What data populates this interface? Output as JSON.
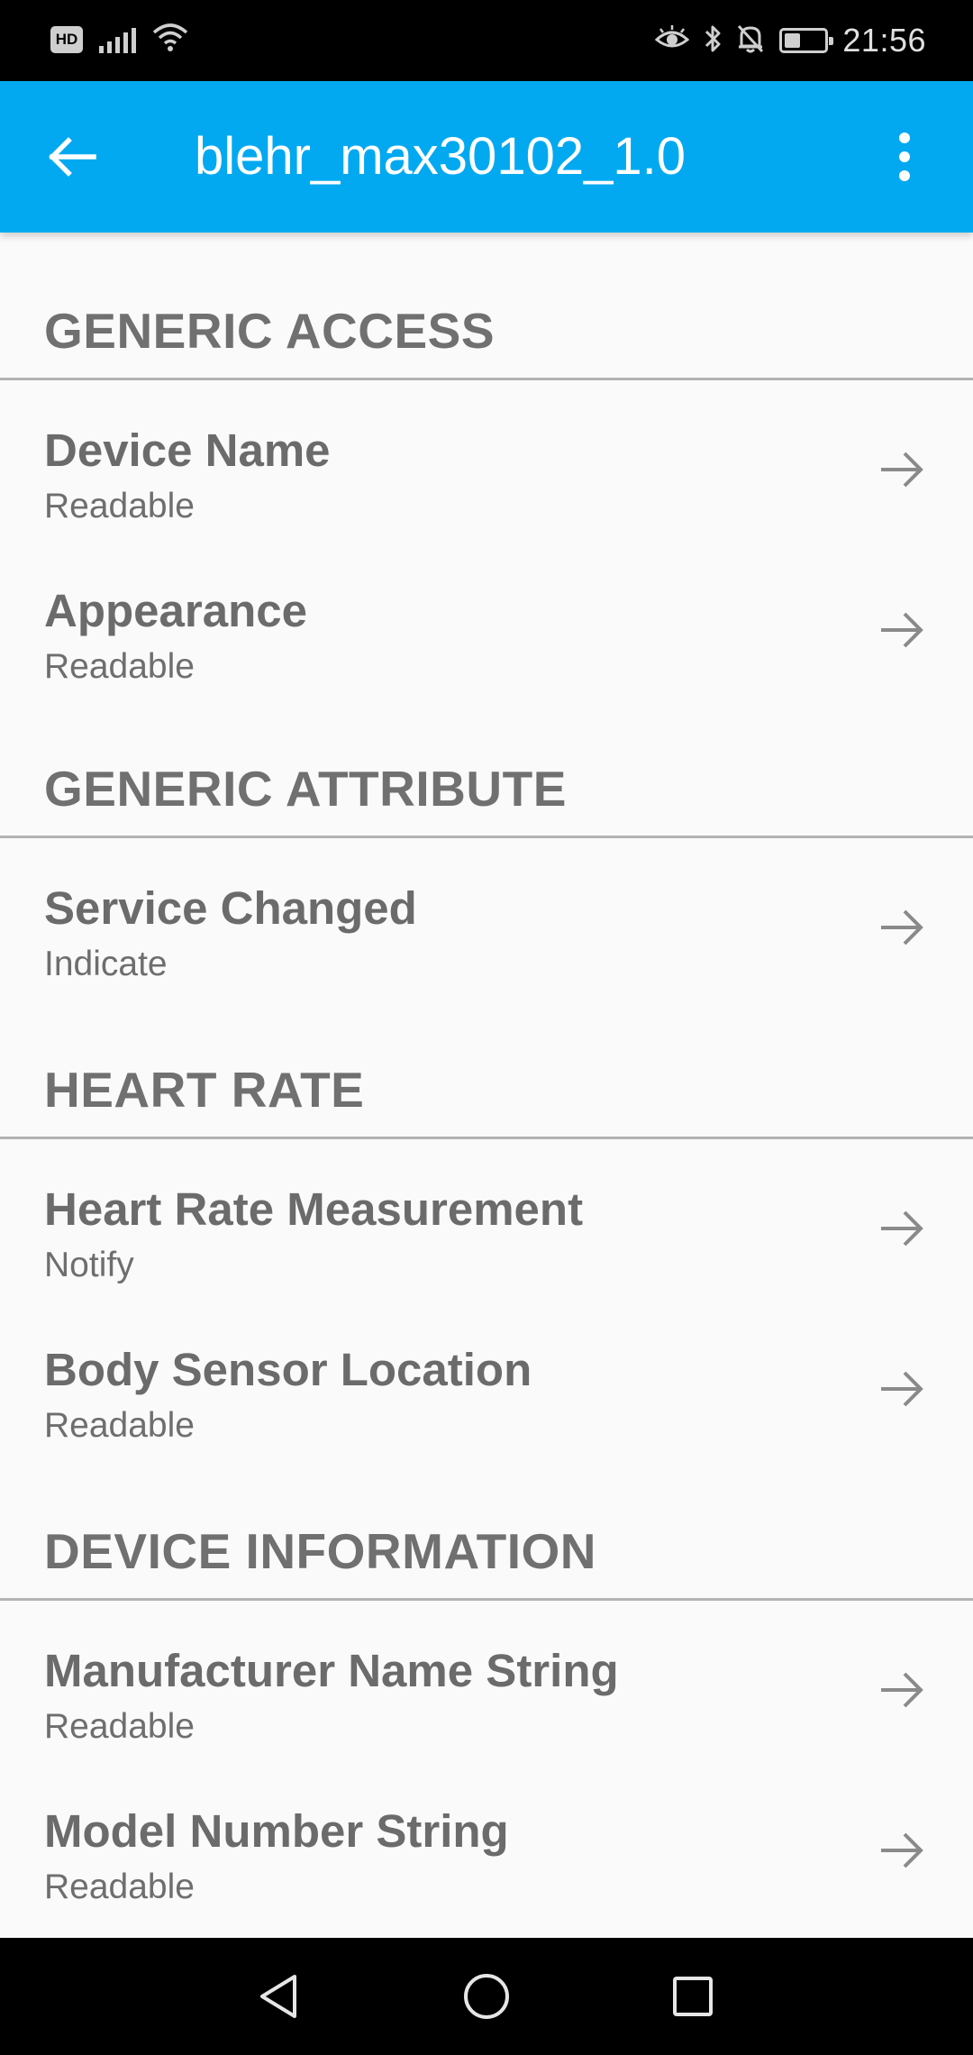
{
  "status_bar": {
    "hd_label": "HD",
    "time": "21:56",
    "icons": [
      "signal-icon",
      "wifi-icon",
      "eye-comfort-icon",
      "bluetooth-icon",
      "mute-bell-icon",
      "battery-icon"
    ],
    "battery_level": 0.4
  },
  "app_bar": {
    "title": "blehr_max30102_1.0",
    "background": "#03a9f0"
  },
  "sections": [
    {
      "title": "GENERIC ACCESS",
      "items": [
        {
          "name": "Device Name",
          "property": "Readable"
        },
        {
          "name": "Appearance",
          "property": "Readable"
        }
      ]
    },
    {
      "title": "GENERIC ATTRIBUTE",
      "items": [
        {
          "name": "Service Changed",
          "property": "Indicate"
        }
      ]
    },
    {
      "title": "HEART RATE",
      "items": [
        {
          "name": "Heart Rate Measurement",
          "property": "Notify"
        },
        {
          "name": "Body Sensor Location",
          "property": "Readable"
        }
      ]
    },
    {
      "title": "DEVICE INFORMATION",
      "items": [
        {
          "name": "Manufacturer Name String",
          "property": "Readable"
        },
        {
          "name": "Model Number String",
          "property": "Readable"
        }
      ]
    }
  ],
  "nav_bar": {
    "buttons": [
      "back-triangle-icon",
      "home-circle-icon",
      "recents-square-icon"
    ]
  }
}
